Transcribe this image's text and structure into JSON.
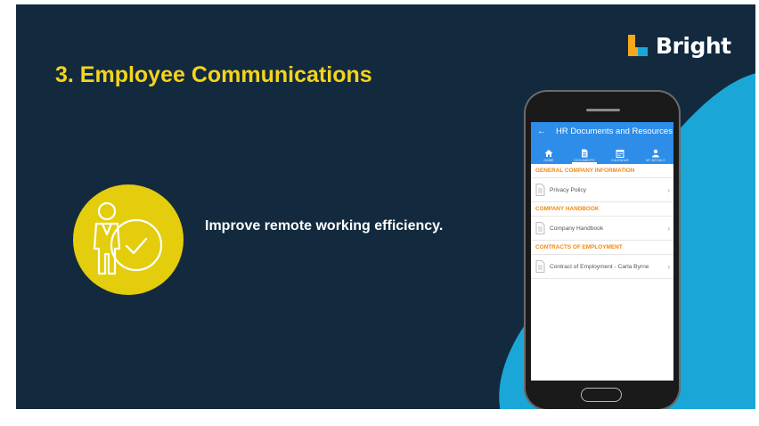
{
  "slide": {
    "title": "3. Employee Communications",
    "feature_text": "Improve remote working efficiency.",
    "logo_text": "Bright"
  },
  "colors": {
    "background": "#132a3e",
    "accent_yellow": "#f4d41c",
    "feature_circle": "#e3cd0d",
    "accent_blue": "#1aa7d8",
    "app_primary": "#2e8de8",
    "section_orange": "#ef8a12"
  },
  "phone": {
    "app_title": "HR Documents and Resources",
    "back_icon": "←",
    "tabs": [
      {
        "label": "HOME",
        "icon": "home-icon"
      },
      {
        "label": "DOCUMENTS",
        "icon": "document-icon"
      },
      {
        "label": "CALENDAR",
        "icon": "calendar-icon"
      },
      {
        "label": "MY DETAILS",
        "icon": "person-icon"
      }
    ],
    "sections": [
      {
        "header": "GENERAL COMPANY INFORMATION",
        "items": [
          "Privacy Policy"
        ]
      },
      {
        "header": "COMPANY HANDBOOK",
        "items": [
          "Company Handbook"
        ]
      },
      {
        "header": "CONTRACTS OF EMPLOYMENT",
        "items": [
          "Contract of Employment - Carla Byrne"
        ]
      }
    ],
    "chevron": "›"
  }
}
